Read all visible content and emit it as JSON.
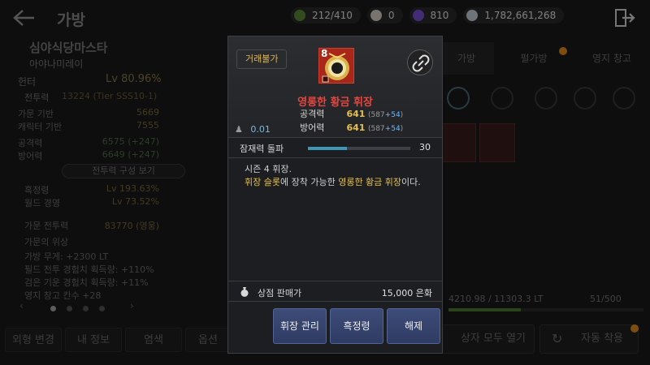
{
  "header": {
    "title": "가방",
    "currencies": [
      {
        "icon": "stamina-icon",
        "value": "212/410",
        "color": "#5d8a3a"
      },
      {
        "icon": "pearl-icon",
        "value": "0",
        "color": "#d9d2c8"
      },
      {
        "icon": "dark-crystal-icon",
        "value": "810",
        "color": "#7a4fd6"
      },
      {
        "icon": "silver-icon",
        "value": "1,782,661,268",
        "color": "#c9d2dc"
      }
    ]
  },
  "left_panel": {
    "family_name": "심야식당마스타",
    "char_name": "아야나미레이",
    "class_name": "헌터",
    "level": "Lv 80.96%",
    "combat_power_label": "전투력",
    "combat_power_value": "13224 (Tier SSS10-1)",
    "family_base_label": "가문 기반",
    "family_base_value": "5669",
    "char_base_label": "캐릭터 기반",
    "char_base_value": "7555",
    "attack_label": "공격력",
    "attack_value": "6575 (+247)",
    "defense_label": "방어력",
    "defense_value": "6649 (+247)",
    "cp_detail_btn": "전투력 구성 보기",
    "black_spirit_label": "흑정령",
    "black_spirit_value": "Lv 193.63%",
    "world_exp_label": "월드 경영",
    "world_exp_value": "Lv 73.52%",
    "family_cp_label": "가문 전투력",
    "family_cp_value": "83770 (영웅)",
    "family_status_label": "가문의 위상",
    "buffs": [
      "가방 무게: +2300 LT",
      "필드 전투 경험치 획득량: +110%",
      "검은 기운 경험치 획득량: +11%",
      "영지 창고 칸수 +28"
    ]
  },
  "bottom_tabs": [
    "외형 변경",
    "내 정보",
    "염색",
    "옵션"
  ],
  "right_panel": {
    "tabs": [
      "가방",
      "펄가방",
      "영지 창고"
    ],
    "weight": "4210.98 / 11303.3 LT",
    "weight_fraction": 0.37,
    "slots": "51/500",
    "open_all": "상자 모두 열기",
    "auto_equip": "자동 착용"
  },
  "tooltip": {
    "untradable": "거래불가",
    "level_badge": "8",
    "item_name": "영롱한 황금 휘장",
    "attack_label": "공격력",
    "attack_value": "641",
    "attack_base": "587",
    "attack_bonus": "+54",
    "defense_label": "방어력",
    "defense_value": "641",
    "defense_base": "587",
    "defense_bonus": "+54",
    "weight": "0.01",
    "awaken_label": "잠재력 돌파",
    "awaken_value": "30",
    "awaken_fraction": 0.38,
    "desc_line1": "시즌 4 휘장.",
    "desc_slot": "휘장 슬롯",
    "desc_mid": "에 장착 가능한 ",
    "desc_item": "영롱한 황금 휘장",
    "desc_end": "이다.",
    "sell_label": "상점 판매가",
    "sell_value": "15,000 은화",
    "buttons": [
      "휘장 관리",
      "흑정령",
      "해제"
    ]
  }
}
